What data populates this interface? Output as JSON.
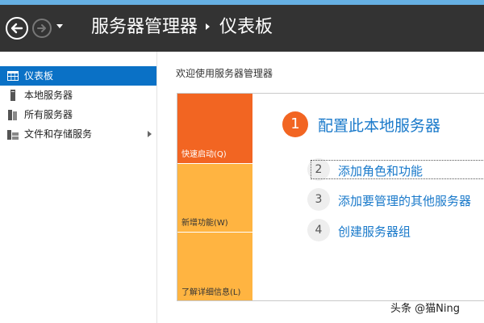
{
  "header": {
    "breadcrumb_root": "服务器管理器",
    "breadcrumb_current": "仪表板"
  },
  "sidebar": {
    "items": [
      {
        "label": "仪表板",
        "icon": "dashboard-icon",
        "active": true
      },
      {
        "label": "本地服务器",
        "icon": "server-icon"
      },
      {
        "label": "所有服务器",
        "icon": "servers-icon"
      },
      {
        "label": "文件和存储服务",
        "icon": "storage-icon",
        "has_submenu": true
      }
    ]
  },
  "main": {
    "welcome": "欢迎使用服务器管理器",
    "tiles": {
      "quick_start": "快速启动(Q)",
      "whats_new": "新增功能(W)",
      "learn_more": "了解详细信息(L)"
    },
    "step1": {
      "number": "1",
      "label": "配置此本地服务器"
    },
    "tasks": [
      {
        "number": "2",
        "label": "添加角色和功能"
      },
      {
        "number": "3",
        "label": "添加要管理的其他服务器"
      },
      {
        "number": "4",
        "label": "创建服务器组"
      }
    ]
  },
  "watermark": "头条 @猫Ning",
  "colors": {
    "accent_blue": "#0a71c6",
    "link_blue": "#1979ca",
    "quick_start_orange": "#f26522",
    "tile_yellow": "#ffb441",
    "header_dark": "#333333"
  }
}
